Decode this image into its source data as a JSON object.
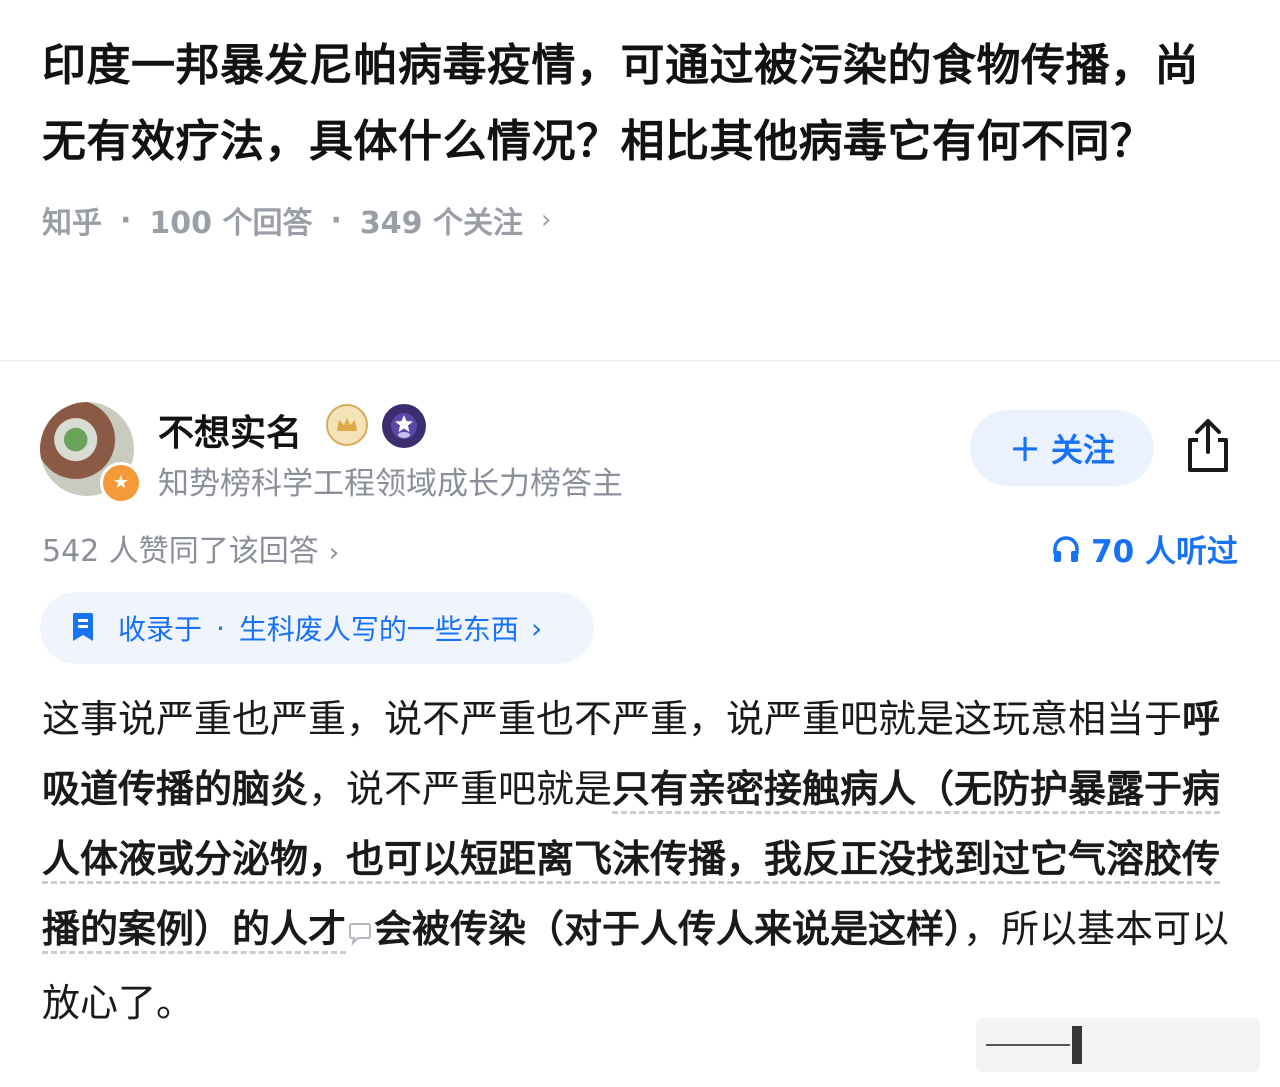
{
  "question": {
    "title": "印度一邦暴发尼帕病毒疫情，可通过被污染的食物传播，尚无有效疗法，具体什么情况？相比其他病毒它有何不同？",
    "source": "知乎",
    "answers_count": "100 个回答",
    "followers_count": "349 个关注"
  },
  "author": {
    "name": "不想实名",
    "title": "知势榜科学工程领域成长力榜答主",
    "follow_label": "关注",
    "badges": [
      "crown-badge-icon",
      "star-badge-icon"
    ]
  },
  "stats": {
    "votes": "542 人赞同了该回答",
    "listens": "70 人听过"
  },
  "collection": {
    "prefix": "收录于",
    "name": "生科废人写的一些东西"
  },
  "answer": {
    "part1": "这事说严重也严重，说不严重也不严重，说严重吧就是这玩意相当于",
    "part2": "呼吸道传播的脑炎",
    "part3": "，说不严重吧就是",
    "part4": "只有亲密接触病人（无防护暴露于病人体液或分泌物，也可以短距离飞沫传播，我反正没找到过它气溶胶传播的案例）的人才",
    "part5": "会被传染",
    "part6": "（对于人传人来说是这样）",
    "part7": "，所以基本可以放心了。"
  },
  "colors": {
    "accent": "#1772f6",
    "muted": "#8a8f99",
    "text": "#121212"
  }
}
